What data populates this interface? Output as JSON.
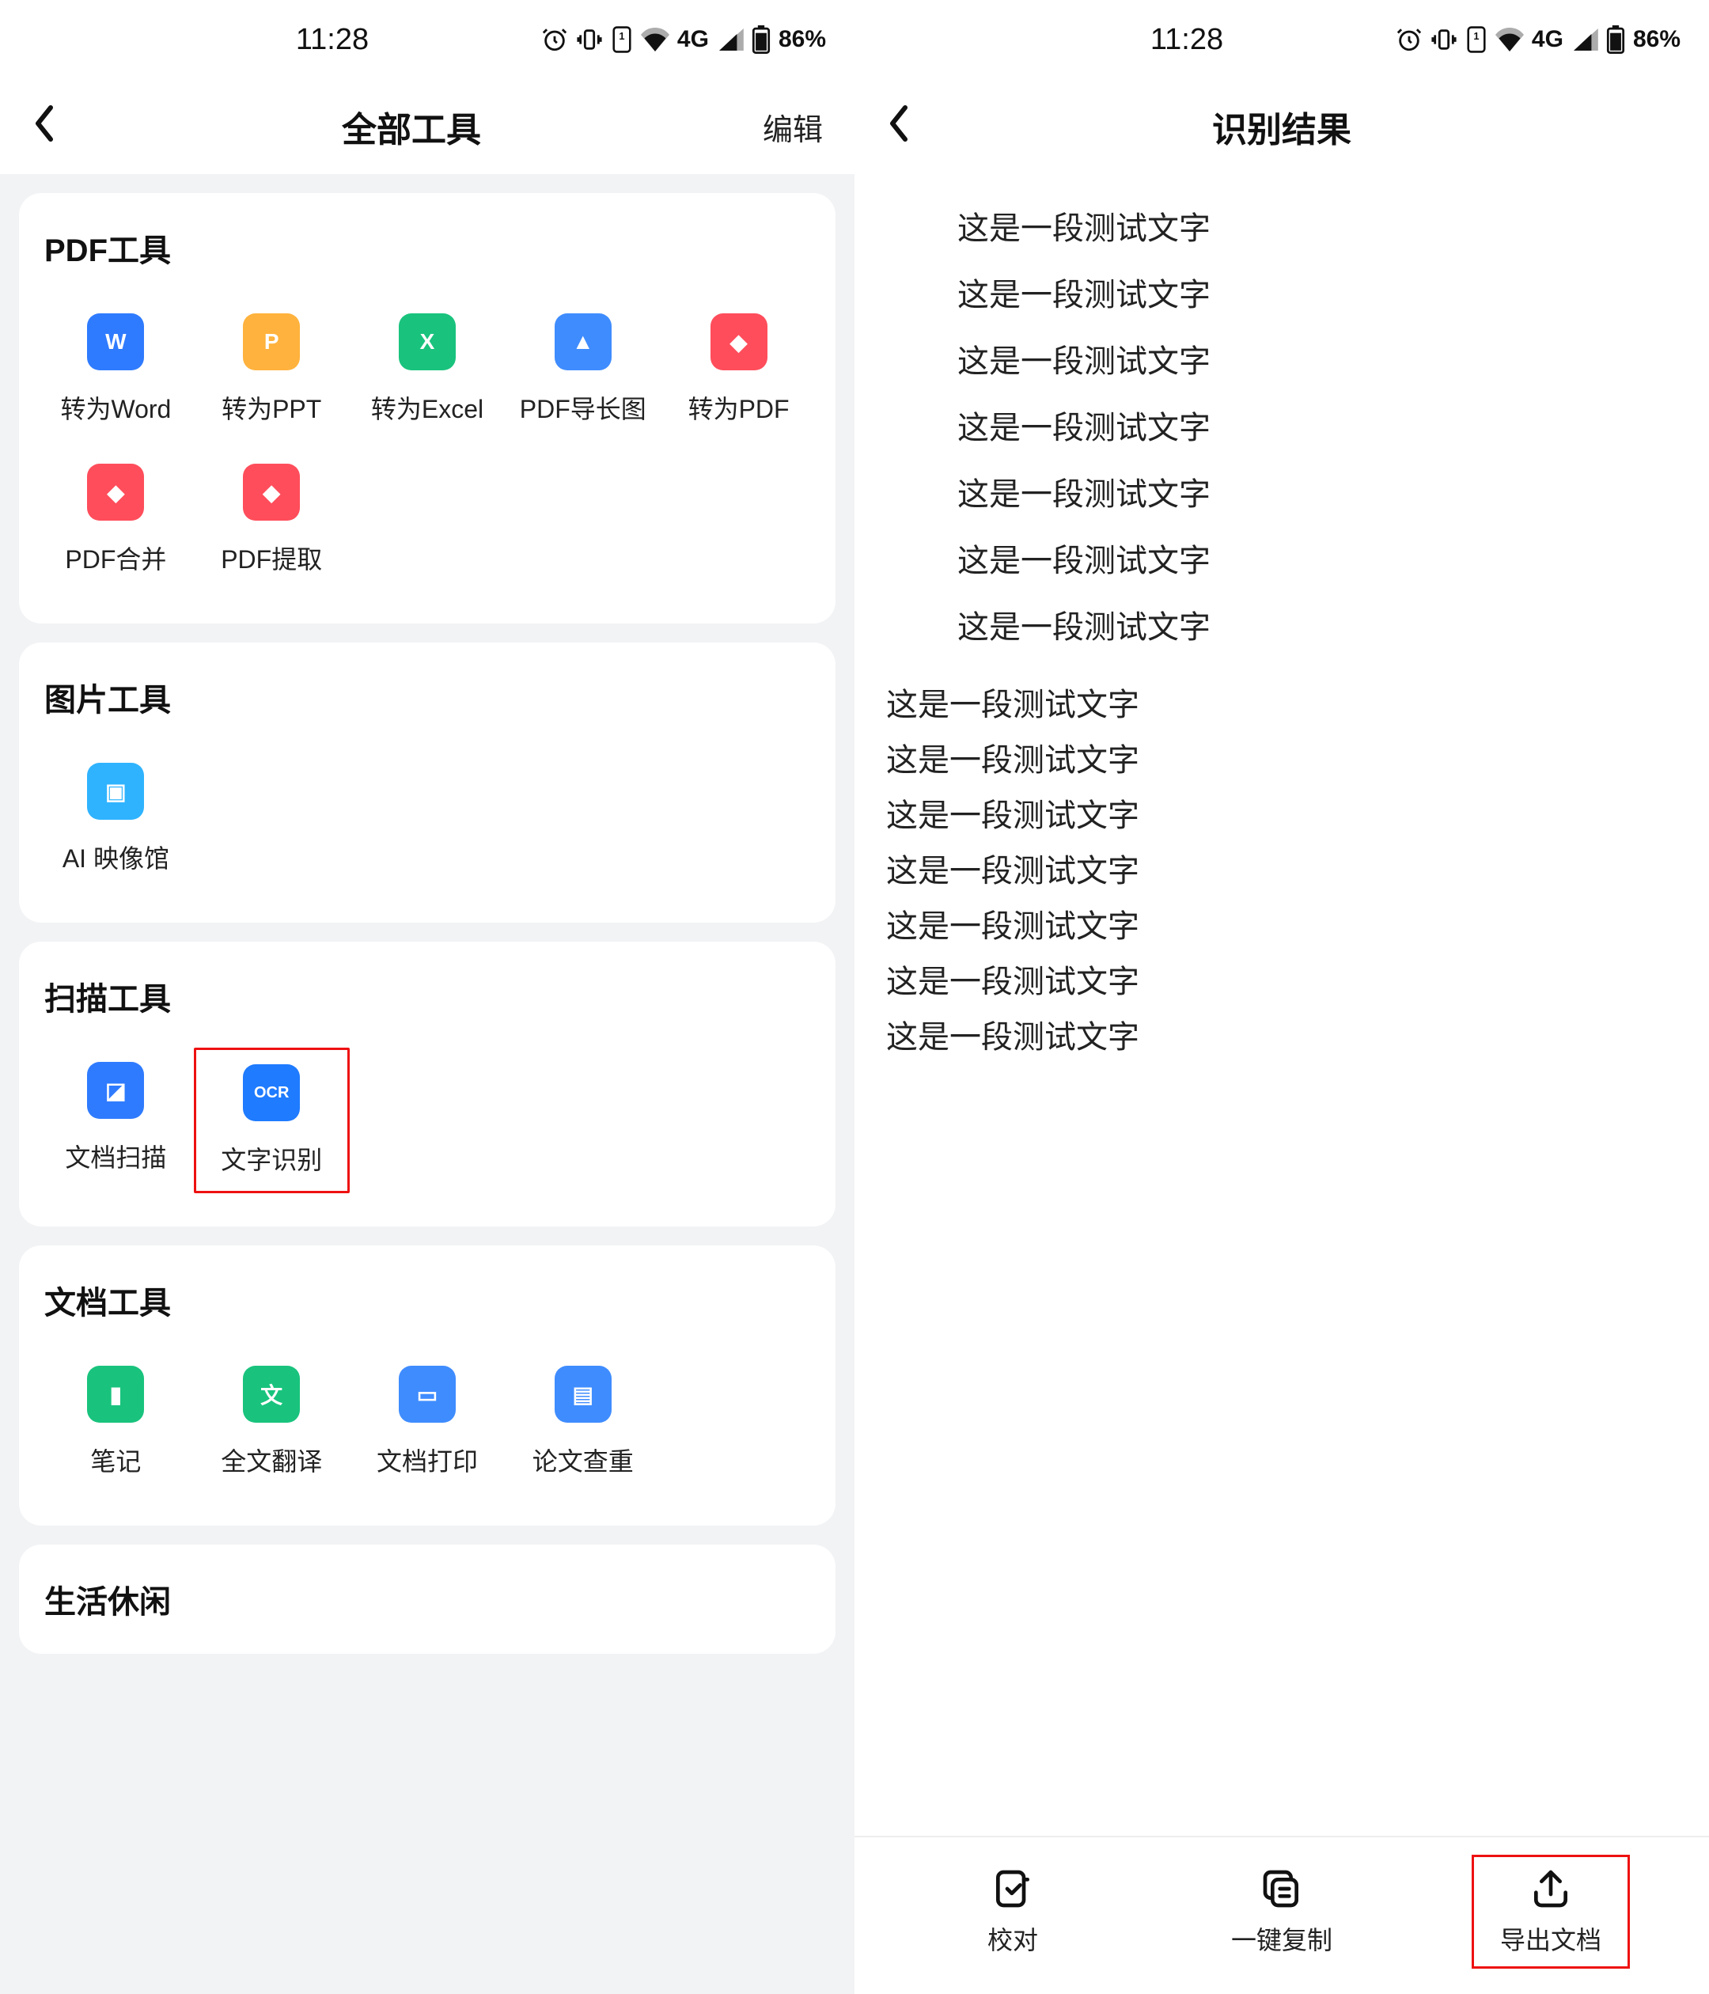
{
  "status": {
    "time": "11:28",
    "network_label": "4G",
    "battery_pct": "86%"
  },
  "left": {
    "title": "全部工具",
    "action": "编辑",
    "sections": {
      "pdf": {
        "title": "PDF工具",
        "tools": [
          {
            "label": "转为Word",
            "glyph": "W",
            "color": "#2f7bff"
          },
          {
            "label": "转为PPT",
            "glyph": "P",
            "color": "#ffb23d"
          },
          {
            "label": "转为Excel",
            "glyph": "X",
            "color": "#19c37d"
          },
          {
            "label": "PDF导长图",
            "glyph": "▲",
            "color": "#3f8cff"
          },
          {
            "label": "转为PDF",
            "glyph": "◆",
            "color": "#ff4d5b"
          },
          {
            "label": "PDF合并",
            "glyph": "◆",
            "color": "#ff4d5b"
          },
          {
            "label": "PDF提取",
            "glyph": "◆",
            "color": "#ff4d5b"
          }
        ]
      },
      "image": {
        "title": "图片工具",
        "tool": {
          "label": "AI 映像馆",
          "glyph": "▣",
          "color": "#2fb3ff"
        }
      },
      "scan": {
        "title": "扫描工具",
        "tools": [
          {
            "label": "文档扫描",
            "glyph": "◪",
            "color": "#2f7bff"
          },
          {
            "label": "文字识别",
            "glyph": "OCR",
            "color": "#1f7bff"
          }
        ]
      },
      "doc": {
        "title": "文档工具",
        "tools": [
          {
            "label": "笔记",
            "glyph": "▮",
            "color": "#19c37d"
          },
          {
            "label": "全文翻译",
            "glyph": "文",
            "color": "#19c37d"
          },
          {
            "label": "文档打印",
            "glyph": "▭",
            "color": "#3f8cff"
          },
          {
            "label": "论文查重",
            "glyph": "▤",
            "color": "#3f8cff"
          }
        ]
      },
      "life": {
        "title": "生活休闲"
      }
    }
  },
  "right": {
    "title": "识别结果",
    "centered_lines": [
      "这是一段测试文字",
      "这是一段测试文字",
      "这是一段测试文字",
      "这是一段测试文字",
      "这是一段测试文字",
      "这是一段测试文字",
      "这是一段测试文字"
    ],
    "left_lines": [
      "这是一段测试文字",
      "这是一段测试文字",
      "这是一段测试文字",
      "这是一段测试文字",
      "这是一段测试文字",
      "这是一段测试文字",
      "这是一段测试文字"
    ],
    "bottom": {
      "proofread": "校对",
      "copy": "一键复制",
      "export": "导出文档"
    }
  }
}
